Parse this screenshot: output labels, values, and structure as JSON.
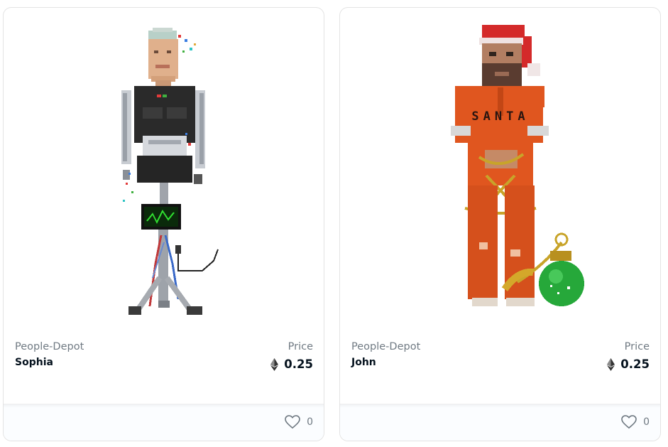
{
  "cards": [
    {
      "collection": "People-Depot",
      "name": "Sophia",
      "price_label": "Price",
      "price": "0.25",
      "likes": "0",
      "currency_icon": "ethereum-icon",
      "like_icon": "heart-icon"
    },
    {
      "collection": "People-Depot",
      "name": "John",
      "price_label": "Price",
      "price": "0.25",
      "likes": "0",
      "currency_icon": "ethereum-icon",
      "like_icon": "heart-icon",
      "art_text": "SANTA"
    }
  ]
}
